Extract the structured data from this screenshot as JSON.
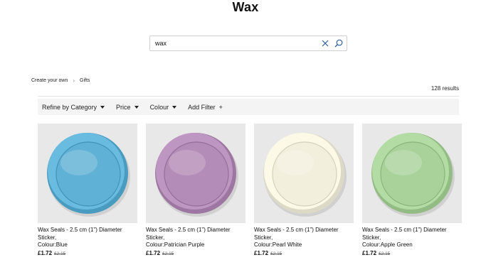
{
  "page": {
    "title": "Wax"
  },
  "search": {
    "value": "wax",
    "placeholder": ""
  },
  "breadcrumb": [
    "Create your own",
    "Gifts"
  ],
  "results": {
    "count_label": "128 results"
  },
  "filters": {
    "category": "Refine by Category",
    "price": "Price",
    "colour": "Colour",
    "add": "Add Filter"
  },
  "products": [
    {
      "line1": "Wax Seals - 2.5 cm (1\") Diameter Sticker,",
      "line2": "Colour:Blue",
      "price": "£1.72",
      "was": "£2.15",
      "color": "#5fb1d6"
    },
    {
      "line1": "Wax Seals - 2.5 cm (1\") Diameter Sticker,",
      "line2": "Colour:Patrician Purple",
      "price": "£1.72",
      "was": "£2.15",
      "color": "#b48cb8"
    },
    {
      "line1": "Wax Seals - 2.5 cm (1\") Diameter Sticker,",
      "line2": "Colour:Pearl White",
      "price": "£1.72",
      "was": "£2.15",
      "color": "#f3efdd"
    },
    {
      "line1": "Wax Seals - 2.5 cm (1\") Diameter Sticker,",
      "line2": "Colour:Apple Green",
      "price": "£1.72",
      "was": "£2.15",
      "color": "#a9d29a"
    }
  ]
}
